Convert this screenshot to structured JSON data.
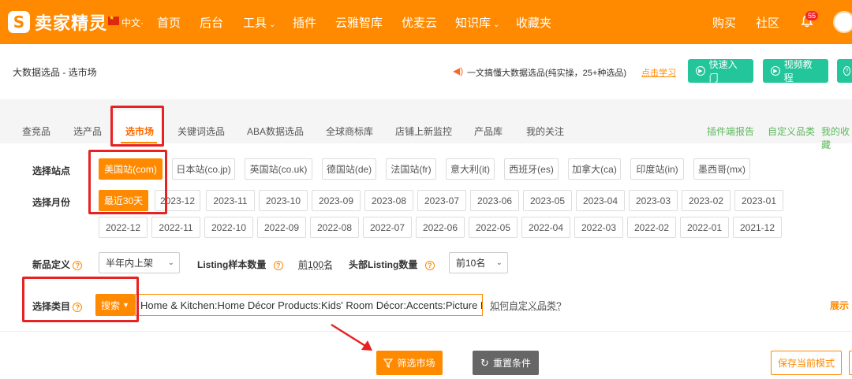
{
  "topnav": {
    "logo_mark": "S",
    "logo_text": "卖家精灵",
    "lang": "中文·",
    "items": [
      {
        "label": "首页"
      },
      {
        "label": "后台"
      },
      {
        "label": "工具",
        "caret": "⌄"
      },
      {
        "label": "插件"
      },
      {
        "label": "云雅智库"
      },
      {
        "label": "优麦云"
      },
      {
        "label": "知识库",
        "caret": "⌄"
      },
      {
        "label": "收藏夹"
      }
    ],
    "right_items": [
      {
        "label": "购买"
      },
      {
        "label": "社区"
      }
    ],
    "notification_count": "55"
  },
  "header": {
    "title": "大数据选品 - 选市场",
    "notice_text": "一文搞懂大数据选品(纯实操，25+种选品)",
    "notice_link": "点击学习",
    "buttons": [
      {
        "label": "快速入门",
        "icon": "play-circle-icon"
      },
      {
        "label": "视频教程",
        "icon": "play-circle-icon"
      },
      {
        "label": "?",
        "icon": "help-circle-icon"
      }
    ]
  },
  "tabs": [
    {
      "label": "查竞品"
    },
    {
      "label": "选产品"
    },
    {
      "label": "选市场",
      "active": true
    },
    {
      "label": "关键词选品"
    },
    {
      "label": "ABA数据选品"
    },
    {
      "label": "全球商标库"
    },
    {
      "label": "店铺上新监控"
    },
    {
      "label": "产品库"
    },
    {
      "label": "我的关注"
    }
  ],
  "right_links": [
    {
      "label": "插件端报告"
    },
    {
      "label": "自定义品类"
    },
    {
      "label": "我的收藏"
    }
  ],
  "filters": {
    "site_label": "选择站点",
    "sites": [
      {
        "label": "美国站(com)",
        "selected": true
      },
      {
        "label": "日本站(co.jp)"
      },
      {
        "label": "英国站(co.uk)"
      },
      {
        "label": "德国站(de)"
      },
      {
        "label": "法国站(fr)"
      },
      {
        "label": "意大利(it)"
      },
      {
        "label": "西班牙(es)"
      },
      {
        "label": "加拿大(ca)"
      },
      {
        "label": "印度站(in)"
      },
      {
        "label": "墨西哥(mx)"
      }
    ],
    "month_label": "选择月份",
    "months_row1": [
      {
        "label": "最近30天",
        "selected": true
      },
      {
        "label": "2023-12"
      },
      {
        "label": "2023-11"
      },
      {
        "label": "2023-10"
      },
      {
        "label": "2023-09"
      },
      {
        "label": "2023-08"
      },
      {
        "label": "2023-07"
      },
      {
        "label": "2023-06"
      },
      {
        "label": "2023-05"
      },
      {
        "label": "2023-04"
      },
      {
        "label": "2023-03"
      },
      {
        "label": "2023-02"
      },
      {
        "label": "2023-01"
      }
    ],
    "months_row2": [
      {
        "label": "2022-12"
      },
      {
        "label": "2022-11"
      },
      {
        "label": "2022-10"
      },
      {
        "label": "2022-09"
      },
      {
        "label": "2022-08"
      },
      {
        "label": "2022-07"
      },
      {
        "label": "2022-06"
      },
      {
        "label": "2022-05"
      },
      {
        "label": "2022-04"
      },
      {
        "label": "2022-03"
      },
      {
        "label": "2022-02"
      },
      {
        "label": "2022-01"
      },
      {
        "label": "2021-12"
      }
    ],
    "new_product_label": "新品定义",
    "new_product_value": "半年内上架",
    "listing_sample_label": "Listing样本数量",
    "listing_sample_value": "前100名",
    "head_listing_label": "头部Listing数量",
    "head_listing_value": "前10名",
    "category_label": "选择类目",
    "category_mode": "搜索",
    "category_value": "Home & Kitchen:Home Décor Products:Kids' Room Décor:Accents:Picture Frar",
    "custom_category_link": "如何自定义品类?",
    "expand_link": "展示"
  },
  "actions": {
    "filter_label": "筛选市场",
    "reset_label": "重置条件",
    "save_label": "保存当前模式"
  },
  "colors": {
    "brand": "#ff8a00",
    "green": "#23c59b",
    "annotation_red": "#e62222"
  }
}
